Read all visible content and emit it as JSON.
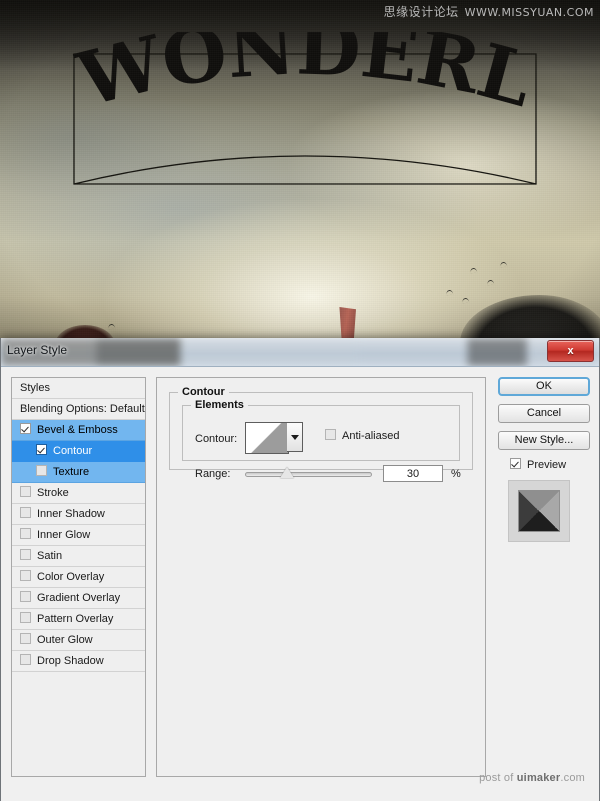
{
  "canvas": {
    "artwork_text": "WONDERLAND",
    "watermark_top_cn": "思缘设计论坛",
    "watermark_top_url": "WWW.MISSYUAN.COM"
  },
  "dialog": {
    "title": "Layer Style",
    "close_label": "x",
    "watermark_bottom_prefix": "post of ",
    "watermark_bottom_brand": "uimaker",
    "watermark_bottom_suffix": ".com"
  },
  "styles_list": {
    "header": "Styles",
    "blending_options": "Blending Options: Default",
    "items": [
      {
        "label": "Bevel & Emboss",
        "checked": true,
        "selected": true,
        "active": false,
        "sub": false
      },
      {
        "label": "Contour",
        "checked": true,
        "selected": true,
        "active": true,
        "sub": true
      },
      {
        "label": "Texture",
        "checked": false,
        "selected": true,
        "active": false,
        "sub": true
      },
      {
        "label": "Stroke",
        "checked": false,
        "selected": false,
        "active": false,
        "sub": false
      },
      {
        "label": "Inner Shadow",
        "checked": false,
        "selected": false,
        "active": false,
        "sub": false
      },
      {
        "label": "Inner Glow",
        "checked": false,
        "selected": false,
        "active": false,
        "sub": false
      },
      {
        "label": "Satin",
        "checked": false,
        "selected": false,
        "active": false,
        "sub": false
      },
      {
        "label": "Color Overlay",
        "checked": false,
        "selected": false,
        "active": false,
        "sub": false
      },
      {
        "label": "Gradient Overlay",
        "checked": false,
        "selected": false,
        "active": false,
        "sub": false
      },
      {
        "label": "Pattern Overlay",
        "checked": false,
        "selected": false,
        "active": false,
        "sub": false
      },
      {
        "label": "Outer Glow",
        "checked": false,
        "selected": false,
        "active": false,
        "sub": false
      },
      {
        "label": "Drop Shadow",
        "checked": false,
        "selected": false,
        "active": false,
        "sub": false
      }
    ]
  },
  "panel": {
    "group_title": "Contour",
    "subgroup_title": "Elements",
    "contour_label": "Contour:",
    "antialiased_label": "Anti-aliased",
    "antialiased_checked": false,
    "range_label": "Range:",
    "range_value": "30",
    "range_unit": "%",
    "range_percent": 30
  },
  "buttons": {
    "ok": "OK",
    "cancel": "Cancel",
    "new_style": "New Style...",
    "preview_label": "Preview",
    "preview_checked": true
  }
}
